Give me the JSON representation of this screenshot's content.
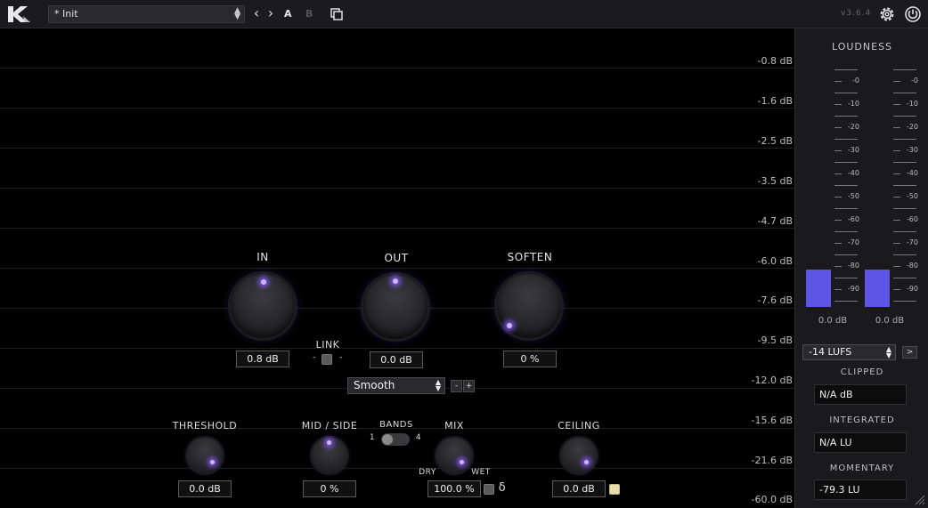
{
  "toolbar": {
    "preset_name": "* Init",
    "prev_label": "‹",
    "next_label": "›",
    "a_label": "A",
    "b_label": "B",
    "version": "v3.6.4",
    "accent": "#6c5cff"
  },
  "meter_scale": [
    "-0.8 dB",
    "-1.6 dB",
    "-2.5 dB",
    "-3.5 dB",
    "-4.7 dB",
    "-6.0 dB",
    "-7.6 dB",
    "-9.5 dB",
    "-12.0 dB",
    "-15.6 dB",
    "-21.6 dB",
    "-60.0 dB"
  ],
  "knobs": {
    "in": {
      "label": "IN",
      "value": "0.8 dB"
    },
    "out": {
      "label": "OUT",
      "value": "0.0 dB"
    },
    "soften": {
      "label": "SOFTEN",
      "value": "0 %"
    },
    "threshold": {
      "label": "THRESHOLD",
      "value": "0.0 dB"
    },
    "midside": {
      "label": "MID / SIDE",
      "value": "0 %"
    },
    "mix": {
      "label": "MIX",
      "value": "100.0 %",
      "dry": "DRY",
      "wet": "WET",
      "delta": "δ"
    },
    "ceiling": {
      "label": "CEILING",
      "value": "0.0 dB"
    }
  },
  "link": {
    "label": "LINK",
    "minus": "-",
    "plus": "-"
  },
  "mode": {
    "selected": "Smooth",
    "minus": "-",
    "plus": "+"
  },
  "bands": {
    "label": "BANDS",
    "min": "1",
    "max": "4"
  },
  "loudness": {
    "title": "LOUDNESS",
    "ticks": [
      "-0",
      "-10",
      "-20",
      "-30",
      "-40",
      "-50",
      "-60",
      "-70",
      "-80",
      "-90"
    ],
    "left_value": "0.0 dB",
    "right_value": "0.0 dB",
    "target": "-14 LUFS",
    "target_btn": ">",
    "clipped_label": "CLIPPED",
    "clipped_value": "N/A dB",
    "integrated_label": "INTEGRATED",
    "integrated_value": "N/A LU",
    "momentary_label": "MOMENTARY",
    "momentary_value": "-79.3 LU",
    "bar_color": "#5d55e8"
  }
}
